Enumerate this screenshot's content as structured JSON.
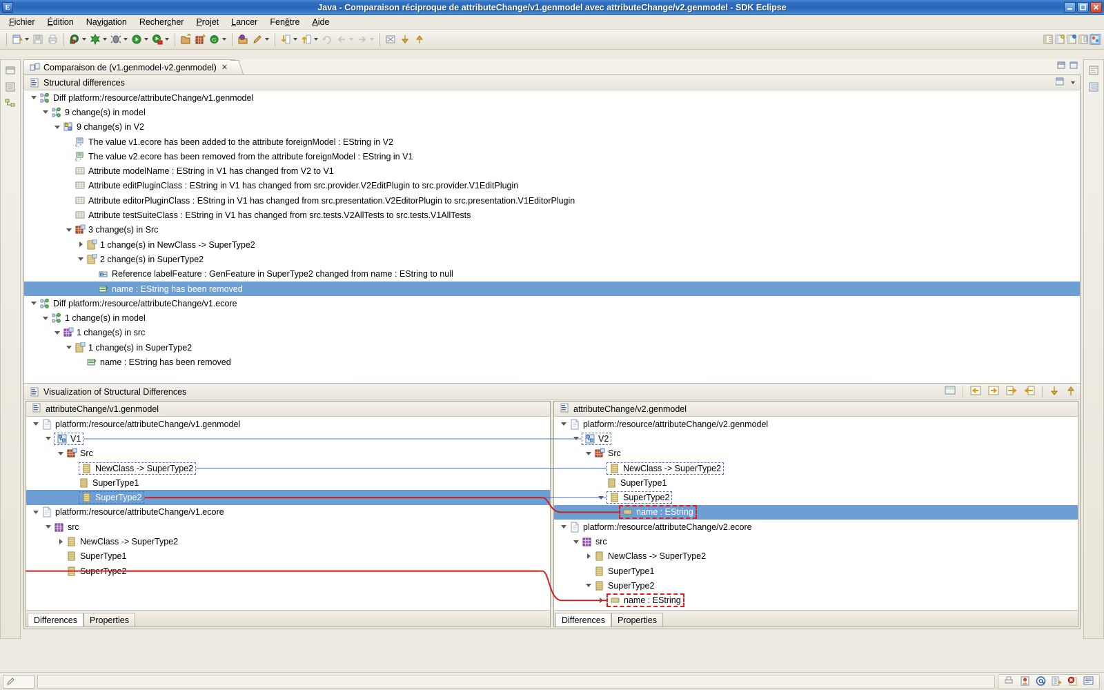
{
  "window": {
    "title": "Java - Comparaison réciproque de attributeChange/v1.genmodel avec attributeChange/v2.genmodel - SDK Eclipse",
    "app_icon": "eclipse-icon",
    "buttons": {
      "minimize": "minimize-button",
      "maximize": "maximize-button",
      "close": "close-button"
    }
  },
  "menubar": {
    "items": [
      {
        "label": "Fichier",
        "mnemonic": "F"
      },
      {
        "label": "Édition",
        "mnemonic": "É"
      },
      {
        "label": "Navigation",
        "mnemonic": "v"
      },
      {
        "label": "Rechercher",
        "mnemonic": "c"
      },
      {
        "label": "Projet",
        "mnemonic": "P"
      },
      {
        "label": "Lancer",
        "mnemonic": "L"
      },
      {
        "label": "Fenêtre",
        "mnemonic": "ê"
      },
      {
        "label": "Aide",
        "mnemonic": "A"
      }
    ]
  },
  "toolbar": {
    "groups": [
      [
        "new-wizard-icon",
        "save-icon",
        "print-icon"
      ],
      [
        "open-type-icon",
        "external-tools-icon",
        "debug-icon",
        "run-icon",
        "run-secure-icon"
      ],
      [
        "new-java-project-icon",
        "new-package-icon",
        "new-class-icon"
      ],
      [
        "open-task-icon",
        "pencil-icon"
      ],
      [
        "next-annotation-icon",
        "previous-annotation-icon",
        "last-edit-icon",
        "back-icon",
        "forward-icon"
      ],
      [
        "toggle-mark-icon",
        "down-arrow-icon",
        "up-arrow-icon"
      ]
    ],
    "right_icons": [
      "perspective-open-icon",
      "perspective-java-icon",
      "perspective-debug-icon",
      "perspective-resource-icon",
      "perspective-active-icon"
    ]
  },
  "editor": {
    "tab": {
      "label": "Comparaison de (v1.genmodel-v2.genmodel)",
      "icon": "compare-editor-icon",
      "close": "✕"
    },
    "minimize_label": "minimize-view",
    "maximize_label": "maximize-view"
  },
  "structural": {
    "header": {
      "label": "Structural differences",
      "icon": "section-icon"
    },
    "menu_icon": "view-menu-icon",
    "rows": [
      {
        "indent": 0,
        "twist": "down",
        "icon": "diff-root-icon",
        "label": "Diff platform:/resource/attributeChange/v1.genmodel",
        "selected": false
      },
      {
        "indent": 1,
        "twist": "down",
        "icon": "diff-root-icon",
        "label": "9 change(s) in model",
        "selected": false
      },
      {
        "indent": 2,
        "twist": "down",
        "icon": "diff-group-icon",
        "label": "9 change(s) in V2",
        "selected": false
      },
      {
        "indent": 3,
        "twist": "none",
        "icon": "value-added-icon",
        "label": "The value v1.ecore has been added to the attribute foreignModel : EString in V2",
        "selected": false
      },
      {
        "indent": 3,
        "twist": "none",
        "icon": "value-removed-icon",
        "label": "The value v2.ecore has been removed from the attribute foreignModel : EString in V1",
        "selected": false
      },
      {
        "indent": 3,
        "twist": "none",
        "icon": "attribute-change-icon",
        "label": "Attribute modelName : EString in V1 has changed from V2 to V1",
        "selected": false
      },
      {
        "indent": 3,
        "twist": "none",
        "icon": "attribute-change-icon",
        "label": "Attribute editPluginClass : EString in V1 has changed from src.provider.V2EditPlugin to src.provider.V1EditPlugin",
        "selected": false
      },
      {
        "indent": 3,
        "twist": "none",
        "icon": "attribute-change-icon",
        "label": "Attribute editorPluginClass : EString in V1 has changed from src.presentation.V2EditorPlugin to src.presentation.V1EditorPlugin",
        "selected": false
      },
      {
        "indent": 3,
        "twist": "none",
        "icon": "attribute-change-icon",
        "label": "Attribute testSuiteClass : EString in V1 has changed from src.tests.V2AllTests to src.tests.V1AllTests",
        "selected": false
      },
      {
        "indent": 3,
        "twist": "down",
        "icon": "package-change-icon",
        "label": "3 change(s) in Src",
        "selected": false
      },
      {
        "indent": 4,
        "twist": "right",
        "icon": "class-change-icon",
        "label": "1 change(s) in NewClass -> SuperType2",
        "selected": false
      },
      {
        "indent": 4,
        "twist": "down",
        "icon": "class-change-icon",
        "label": "2 change(s) in SuperType2",
        "selected": false
      },
      {
        "indent": 5,
        "twist": "none",
        "icon": "reference-change-icon",
        "label": "Reference labelFeature : GenFeature in SuperType2 changed from name : EString to null",
        "selected": false
      },
      {
        "indent": 5,
        "twist": "none",
        "icon": "element-removed-icon",
        "label": "name : EString has been removed",
        "selected": true
      },
      {
        "indent": 0,
        "twist": "down",
        "icon": "diff-root-icon",
        "label": "Diff platform:/resource/attributeChange/v1.ecore",
        "selected": false
      },
      {
        "indent": 1,
        "twist": "down",
        "icon": "diff-root-icon",
        "label": "1 change(s) in model",
        "selected": false
      },
      {
        "indent": 2,
        "twist": "down",
        "icon": "package-purple-icon",
        "label": "1 change(s) in src",
        "selected": false
      },
      {
        "indent": 3,
        "twist": "down",
        "icon": "class-change-icon",
        "label": "1 change(s) in SuperType2",
        "selected": false
      },
      {
        "indent": 4,
        "twist": "none",
        "icon": "element-removed-icon",
        "label": "name : EString has been removed",
        "selected": false
      }
    ]
  },
  "visualization": {
    "header": {
      "label": "Visualization of Structural Differences",
      "icon": "section-icon"
    },
    "toolbar_icons": [
      "show-properties-icon",
      "copy-right-to-left-icon",
      "copy-left-to-right-icon",
      "copy-all-right-to-left-icon",
      "copy-all-left-to-right-icon",
      "next-difference-icon",
      "previous-difference-icon"
    ],
    "left": {
      "header": {
        "label": "attributeChange/v1.genmodel",
        "icon": "file-icon"
      },
      "rows": [
        {
          "indent": 0,
          "twist": "down",
          "icon": "resource-icon",
          "label": "platform:/resource/attributeChange/v1.genmodel",
          "selected": false,
          "box": "none"
        },
        {
          "indent": 1,
          "twist": "down",
          "icon": "genmodel-icon",
          "label": "V1",
          "selected": false,
          "box": "blue"
        },
        {
          "indent": 2,
          "twist": "down",
          "icon": "genpackage-icon",
          "label": "Src",
          "selected": false,
          "box": "none"
        },
        {
          "indent": 3,
          "twist": "none",
          "icon": "genclass-icon",
          "label": "NewClass -> SuperType2",
          "selected": false,
          "box": "blue"
        },
        {
          "indent": 3,
          "twist": "none",
          "icon": "genclass-icon",
          "label": "SuperType1",
          "selected": false,
          "box": "none"
        },
        {
          "indent": 3,
          "twist": "none",
          "icon": "genclass-icon",
          "label": "SuperType2",
          "selected": true,
          "box": "blue"
        },
        {
          "indent": 0,
          "twist": "down",
          "icon": "resource-icon",
          "label": "platform:/resource/attributeChange/v1.ecore",
          "selected": false,
          "box": "none"
        },
        {
          "indent": 1,
          "twist": "down",
          "icon": "epackage-icon",
          "label": "src",
          "selected": false,
          "box": "none"
        },
        {
          "indent": 2,
          "twist": "right",
          "icon": "eclass-icon",
          "label": "NewClass -> SuperType2",
          "selected": false,
          "box": "none"
        },
        {
          "indent": 2,
          "twist": "none",
          "icon": "eclass-icon",
          "label": "SuperType1",
          "selected": false,
          "box": "none"
        },
        {
          "indent": 2,
          "twist": "none",
          "icon": "eclass-icon",
          "label": "SuperType2",
          "selected": false,
          "box": "none"
        }
      ],
      "tabs": [
        {
          "label": "Differences",
          "active": true
        },
        {
          "label": "Properties",
          "active": false
        }
      ]
    },
    "right": {
      "header": {
        "label": "attributeChange/v2.genmodel",
        "icon": "file-icon"
      },
      "rows": [
        {
          "indent": 0,
          "twist": "down",
          "icon": "resource-icon",
          "label": "platform:/resource/attributeChange/v2.genmodel",
          "selected": false,
          "box": "none"
        },
        {
          "indent": 1,
          "twist": "down",
          "icon": "genmodel-icon",
          "label": "V2",
          "selected": false,
          "box": "blue"
        },
        {
          "indent": 2,
          "twist": "down",
          "icon": "genpackage-icon",
          "label": "Src",
          "selected": false,
          "box": "none"
        },
        {
          "indent": 3,
          "twist": "none",
          "icon": "genclass-icon",
          "label": "NewClass -> SuperType2",
          "selected": false,
          "box": "blue"
        },
        {
          "indent": 3,
          "twist": "none",
          "icon": "genclass-icon",
          "label": "SuperType1",
          "selected": false,
          "box": "none"
        },
        {
          "indent": 3,
          "twist": "down",
          "icon": "genclass-icon",
          "label": "SuperType2",
          "selected": false,
          "box": "blue"
        },
        {
          "indent": 4,
          "twist": "none",
          "icon": "genfeature-icon",
          "label": "name : EString",
          "selected": true,
          "box": "red"
        },
        {
          "indent": 0,
          "twist": "down",
          "icon": "resource-icon",
          "label": "platform:/resource/attributeChange/v2.ecore",
          "selected": false,
          "box": "none"
        },
        {
          "indent": 1,
          "twist": "down",
          "icon": "epackage-icon",
          "label": "src",
          "selected": false,
          "box": "none"
        },
        {
          "indent": 2,
          "twist": "right",
          "icon": "eclass-icon",
          "label": "NewClass -> SuperType2",
          "selected": false,
          "box": "none"
        },
        {
          "indent": 2,
          "twist": "none",
          "icon": "eclass-icon",
          "label": "SuperType1",
          "selected": false,
          "box": "none"
        },
        {
          "indent": 2,
          "twist": "down",
          "icon": "eclass-icon",
          "label": "SuperType2",
          "selected": false,
          "box": "none"
        },
        {
          "indent": 3,
          "twist": "right",
          "icon": "eattribute-icon",
          "label": "name : EString",
          "selected": false,
          "box": "red"
        }
      ],
      "tabs": [
        {
          "label": "Differences",
          "active": true
        },
        {
          "label": "Properties",
          "active": false
        }
      ]
    }
  },
  "statusbar": {
    "left_icon": "writable-indicator",
    "right_icons": [
      "print-small-icon",
      "bookmark-icon",
      "at-icon",
      "task-icon",
      "error-icon",
      "console-icon"
    ]
  },
  "colors": {
    "selection": "#6d9fd4",
    "diff_blue": "#4a72c8",
    "diff_red": "#d42a2a",
    "title_bar": "#2f6fc0",
    "chrome": "#ece9e1"
  }
}
